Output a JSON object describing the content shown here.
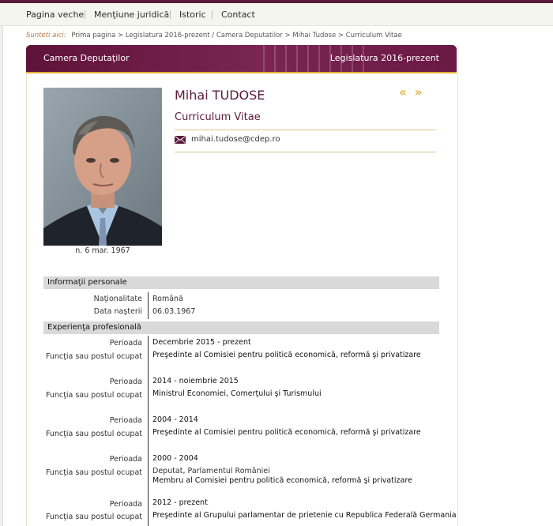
{
  "nav": {
    "items": [
      "Pagina veche",
      "Menţiune juridică",
      "Istoric",
      "Contact"
    ]
  },
  "breadcrumb": {
    "lead": "Sunteti aici:",
    "items": [
      "Prima pagina",
      "Legislatura 2016-prezent",
      "Camera Deputatilor",
      "Mihai Tudose",
      "Curriculum Vitae"
    ]
  },
  "banner": {
    "left": "Camera Deputaţilor",
    "right": "Legislatura 2016-prezent"
  },
  "profile": {
    "name": "Mihai TUDOSE",
    "subtitle": "Curriculum Vitae",
    "email": "mihai.tudose@cdep.ro",
    "birth_caption": "n. 6 mar. 1967",
    "nav_prev": "«",
    "nav_next": "»"
  },
  "personal": {
    "title": "Informaţii personale",
    "rows": [
      {
        "label": "Naţionalitate",
        "value": "Română"
      },
      {
        "label": "Data naşterii",
        "value": "06.03.1967"
      }
    ]
  },
  "experience": {
    "title": "Experienţa profesională",
    "period_label": "Perioada",
    "role_label": "Funcţia sau postul ocupat",
    "entries": [
      {
        "period": "Decembrie 2015 - prezent",
        "org": "",
        "role": "Preşedinte al Comisiei pentru politică economică, reformă şi privatizare"
      },
      {
        "period": "2014 - noiembrie 2015",
        "org": "",
        "role": "Ministrul Economiei, Comerţului şi Turismului"
      },
      {
        "period": "2004 - 2014",
        "org": "",
        "role": "Preşedinte al Comisiei pentru politică economică, reformă şi privatizare"
      },
      {
        "period": "2000 - 2004",
        "org": "Deputat, Parlamentul României",
        "role": "Membru al Comisiei pentru politică economică, reformă şi privatizare"
      },
      {
        "period": "2012 - prezent",
        "org": "",
        "role": "Preşedinte al Grupului parlamentar de prietenie cu Republica Federală Germania"
      }
    ]
  }
}
